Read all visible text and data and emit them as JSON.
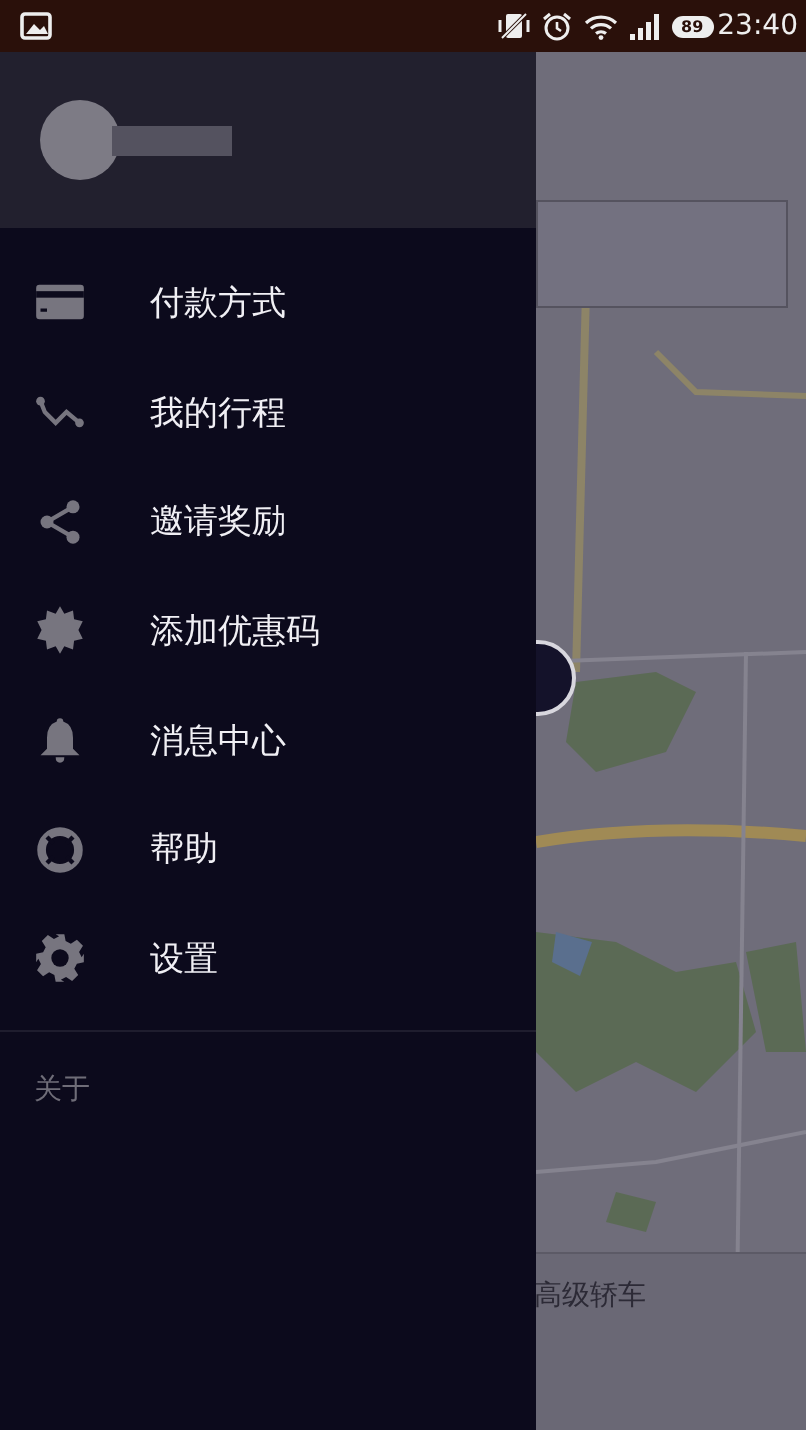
{
  "status_bar": {
    "battery": "89",
    "time": "23:40"
  },
  "drawer": {
    "menu_items": [
      {
        "label": "付款方式"
      },
      {
        "label": "我的行程"
      },
      {
        "label": "邀请奖励"
      },
      {
        "label": "添加优惠码"
      },
      {
        "label": "消息中心"
      },
      {
        "label": "帮助"
      },
      {
        "label": "设置"
      }
    ],
    "footer_link": "关于"
  },
  "map_screen": {
    "bottom_label": "高级轿车"
  }
}
